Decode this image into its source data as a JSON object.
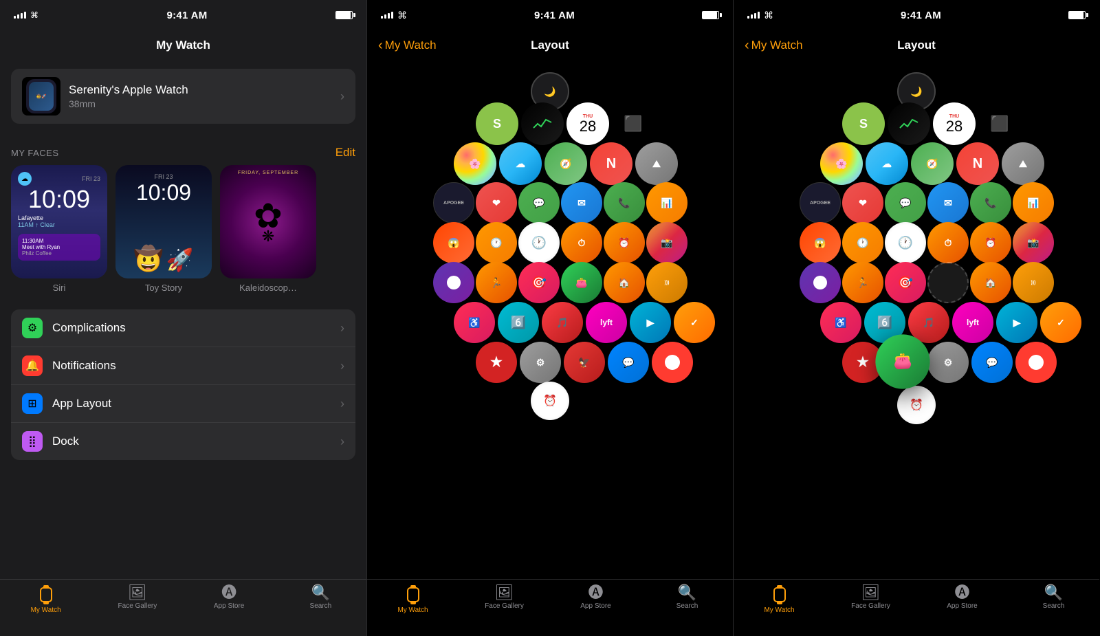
{
  "panels": [
    {
      "id": "panel1",
      "status": {
        "time": "9:41 AM",
        "signal": true,
        "wifi": true,
        "battery": "full"
      },
      "nav": {
        "title": "My Watch",
        "back": null
      },
      "watch": {
        "name": "Serenity's Apple Watch",
        "size": "38mm"
      },
      "faces_section": {
        "label": "MY FACES",
        "edit_label": "Edit",
        "faces": [
          {
            "name": "Siri",
            "style": "siri"
          },
          {
            "name": "Toy Story",
            "style": "toy-story"
          },
          {
            "name": "Kaleidoscop…",
            "style": "kaleidoscope"
          }
        ]
      },
      "settings": [
        {
          "label": "Complications",
          "icon": "⚙",
          "icon_style": "green"
        },
        {
          "label": "Notifications",
          "icon": "🔔",
          "icon_style": "red"
        },
        {
          "label": "App Layout",
          "icon": "⊞",
          "icon_style": "blue"
        },
        {
          "label": "Dock",
          "icon": "⣿",
          "icon_style": "purple"
        }
      ],
      "tabs": [
        {
          "label": "My Watch",
          "active": true
        },
        {
          "label": "Face Gallery",
          "active": false
        },
        {
          "label": "App Store",
          "active": false
        },
        {
          "label": "Search",
          "active": false
        }
      ]
    },
    {
      "id": "panel2",
      "status": {
        "time": "9:41 AM"
      },
      "nav": {
        "title": "Layout",
        "back": "My Watch"
      },
      "tabs": [
        {
          "label": "My Watch",
          "active": true
        },
        {
          "label": "Face Gallery",
          "active": false
        },
        {
          "label": "App Store",
          "active": false
        },
        {
          "label": "Search",
          "active": false
        }
      ]
    },
    {
      "id": "panel3",
      "status": {
        "time": "9:41 AM"
      },
      "nav": {
        "title": "Layout",
        "back": "My Watch"
      },
      "tabs": [
        {
          "label": "My Watch",
          "active": true
        },
        {
          "label": "Face Gallery",
          "active": false
        },
        {
          "label": "App Store",
          "active": false
        },
        {
          "label": "Search",
          "active": false
        }
      ]
    }
  ]
}
